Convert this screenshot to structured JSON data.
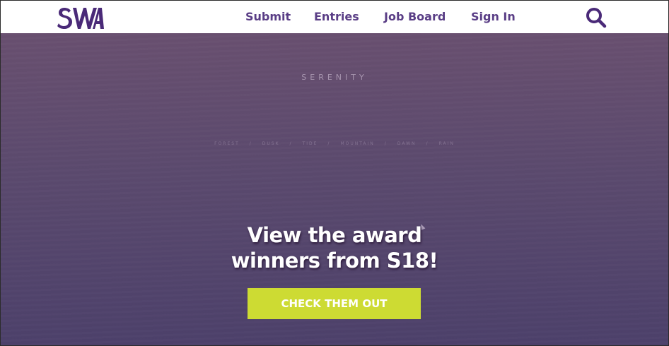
{
  "header": {
    "logo_text": "SWA",
    "nav": [
      {
        "label": "Submit"
      },
      {
        "label": "Entries"
      },
      {
        "label": "Job Board"
      },
      {
        "label": "Sign In"
      }
    ],
    "search_icon": "search-icon"
  },
  "hero": {
    "serenity": "SERENITY",
    "sub_nav": [
      "FOREST",
      "DUSK",
      "TIDE",
      "MOUNTAIN",
      "DAWN",
      "RAIN"
    ],
    "sub_nav_separator": "/",
    "headline_line1": "View the award",
    "headline_line2": "winners from S18!",
    "cta_label": "CHECK THEM OUT"
  },
  "colors": {
    "brand_purple": "#4a2a78",
    "nav_text": "#5a3e86",
    "hero_top": "#695070",
    "hero_bottom": "#4d416b",
    "cta_background": "#cddb33",
    "cta_text": "#ffffff"
  }
}
